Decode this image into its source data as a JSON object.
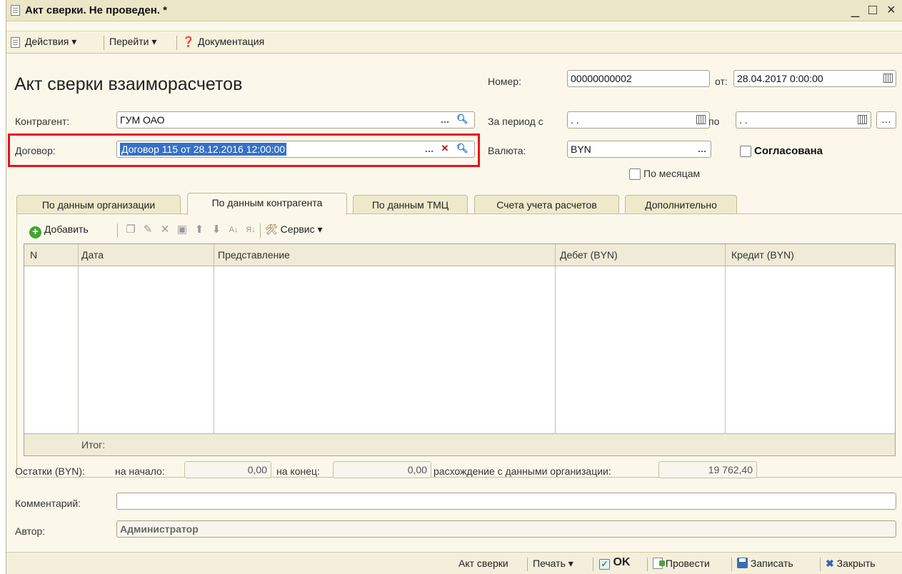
{
  "window": {
    "title": "Акт сверки. Не проведен. *",
    "controls": {
      "minimize": "_",
      "maximize": "□",
      "close": "×"
    }
  },
  "toolbar": {
    "actions": "Действия ▾",
    "goto": "Перейти ▾",
    "docs": "Документация"
  },
  "form": {
    "heading": "Акт сверки взаиморасчетов",
    "number_label": "Номер:",
    "number_value": "00000000002",
    "date_label": "от:",
    "date_value": "28.04.2017  0:00:00",
    "counterparty_label": "Контрагент:",
    "counterparty_value": "ГУМ ОАО",
    "period_label": "За период с",
    "period_from": " . .",
    "period_to_label": "по",
    "period_to": " . .",
    "contract_label": "Договор:",
    "contract_value": "Договор  115 от 28.12.2016 12:00:00",
    "currency_label": "Валюта:",
    "currency_value": "BYN",
    "agreed_label": "Согласована",
    "by_months_label": "По месяцам"
  },
  "tabs": [
    {
      "label": "По данным организации",
      "active": false
    },
    {
      "label": "По данным контрагента",
      "active": true
    },
    {
      "label": "По данным ТМЦ",
      "active": false
    },
    {
      "label": "Счета учета расчетов",
      "active": false
    },
    {
      "label": "Дополнительно",
      "active": false
    }
  ],
  "grid_toolbar": {
    "add": "Добавить",
    "service": "Сервис ▾"
  },
  "table": {
    "columns": [
      "N",
      "Дата",
      "Представление",
      "Дебет (BYN)",
      "Кредит (BYN)"
    ],
    "rows": [],
    "footer_label": "Итог:"
  },
  "balances": {
    "label": "Остатки (BYN):",
    "start_label": "на начало:",
    "start_value": "0,00",
    "end_label": "на конец:",
    "end_value": "0,00",
    "diff_label": "расхождение с данными организации:",
    "diff_value": "19 762,40"
  },
  "comment": {
    "label": "Комментарий:",
    "value": ""
  },
  "author": {
    "label": "Автор:",
    "value": "Администратор"
  },
  "bottombar": {
    "act": "Акт сверки",
    "print": "Печать ▾",
    "ok": "OK",
    "post": "Провести",
    "save": "Записать",
    "close": "Закрыть"
  },
  "colors": {
    "highlight": "#e8131a",
    "selection": "#3670c6",
    "window_bg": "#fbf8eb"
  }
}
